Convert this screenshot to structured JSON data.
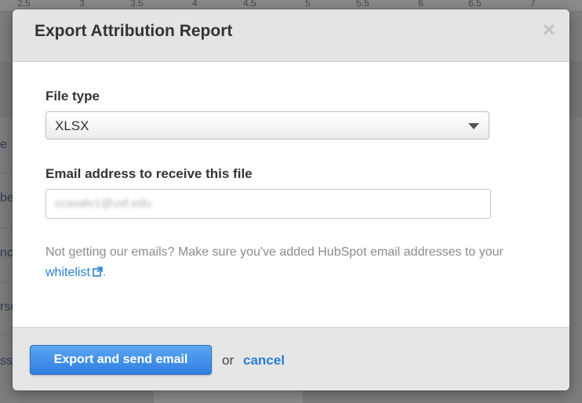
{
  "background": {
    "ruler_ticks": [
      "2.5",
      "3",
      "3.5",
      "4",
      "4.5",
      "5",
      "5.5",
      "6",
      "6.5",
      "7"
    ],
    "row_fragments": [
      "e",
      "be",
      "nc",
      "rse",
      "ss"
    ]
  },
  "modal": {
    "title": "Export Attribution Report",
    "close_icon": "close-icon",
    "file_type": {
      "label": "File type",
      "selected": "XLSX"
    },
    "email": {
      "label": "Email address to receive this file",
      "value": "ccasalv1@usf.edu"
    },
    "help": {
      "prefix": "Not getting our emails? Make sure you've added HubSpot email addresses to your ",
      "link": "whitelist",
      "suffix": "."
    },
    "footer": {
      "export_button": "Export and send email",
      "or_text": "or",
      "cancel_link": "cancel"
    }
  },
  "colors": {
    "link": "#2a7fd1",
    "primary_button": "#2f7fe0",
    "header_bg": "#e4e4e4"
  }
}
